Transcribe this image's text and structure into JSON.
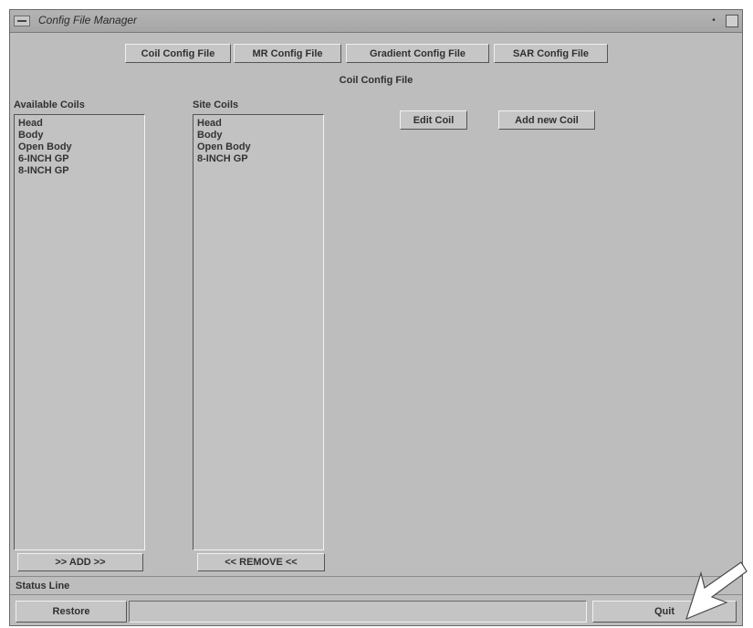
{
  "window": {
    "title": "Config File Manager"
  },
  "tabs": [
    {
      "label": "Coil Config File"
    },
    {
      "label": "MR Config File"
    },
    {
      "label": "Gradient Config File"
    },
    {
      "label": "SAR Config File"
    }
  ],
  "section_title": "Coil Config File",
  "available_coils": {
    "label": "Available Coils",
    "items": [
      "Head",
      "Body",
      "Open Body",
      "6-INCH GP",
      "8-INCH GP"
    ],
    "button": ">> ADD >>"
  },
  "site_coils": {
    "label": "Site Coils",
    "items": [
      "Head",
      "Body",
      "Open Body",
      "8-INCH GP"
    ],
    "button": "<< REMOVE <<"
  },
  "actions": {
    "edit_coil": "Edit Coil",
    "add_new_coil": "Add new Coil"
  },
  "status": {
    "label": "Status Line",
    "value": ""
  },
  "footer": {
    "restore": "Restore",
    "quit": "Quit"
  },
  "icons": {
    "window_menu": "window-menu-icon",
    "minimize": "minimize-icon",
    "maximize": "maximize-icon",
    "pointer": "arrow-pointer-icon"
  }
}
